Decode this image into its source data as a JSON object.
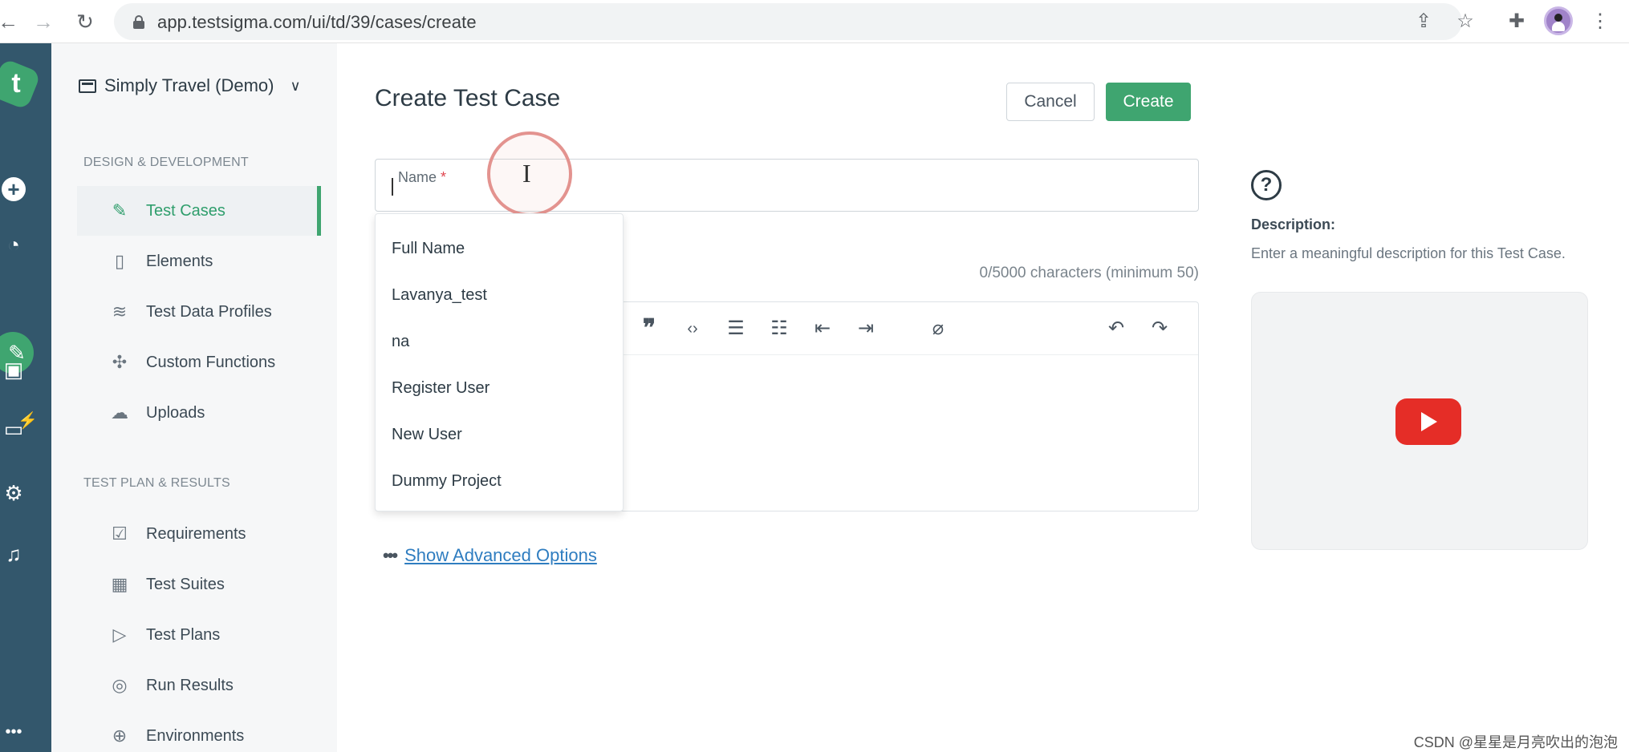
{
  "browser": {
    "url": "app.testsigma.com/ui/td/39/cases/create"
  },
  "rail": {
    "items": [
      "logo-icon",
      "add-icon",
      "dashboard-icon",
      "edit-icon",
      "briefcase-icon",
      "monitor-icon",
      "settings-icon",
      "bell-icon",
      "more-icon"
    ]
  },
  "sidebar": {
    "workspace": "Simply Travel (Demo)",
    "section_design": "DESIGN & DEVELOPMENT",
    "design_items": [
      {
        "label": "Test Cases",
        "icon": "test-cases-icon",
        "active": true
      },
      {
        "label": "Elements",
        "icon": "elements-icon"
      },
      {
        "label": "Test Data Profiles",
        "icon": "database-icon"
      },
      {
        "label": "Custom Functions",
        "icon": "puzzle-icon"
      },
      {
        "label": "Uploads",
        "icon": "cloud-upload-icon"
      }
    ],
    "section_plan": "TEST PLAN & RESULTS",
    "plan_items": [
      {
        "label": "Requirements",
        "icon": "requirements-icon"
      },
      {
        "label": "Test Suites",
        "icon": "test-suites-icon"
      },
      {
        "label": "Test Plans",
        "icon": "test-plans-icon"
      },
      {
        "label": "Run Results",
        "icon": "run-results-icon"
      },
      {
        "label": "Environments",
        "icon": "environments-icon"
      }
    ]
  },
  "main": {
    "title": "Create Test Case",
    "cancel_label": "Cancel",
    "create_label": "Create",
    "name_label": "Name",
    "required_mark": "*",
    "name_value": "",
    "char_count": "0/5000 characters (minimum 50)",
    "suggestions": [
      "Full Name",
      "Lavanya_test",
      "na",
      "Register User",
      "New User",
      "Dummy Project"
    ],
    "advanced_options": "Show Advanced Options"
  },
  "help": {
    "title": "Description:",
    "text": "Enter a meaningful description for this Test Case."
  },
  "colors": {
    "accent": "#3fa570",
    "rail": "#33576c",
    "link": "#2f7dc0"
  },
  "watermark": "CSDN @星星是月亮吹出的泡泡"
}
